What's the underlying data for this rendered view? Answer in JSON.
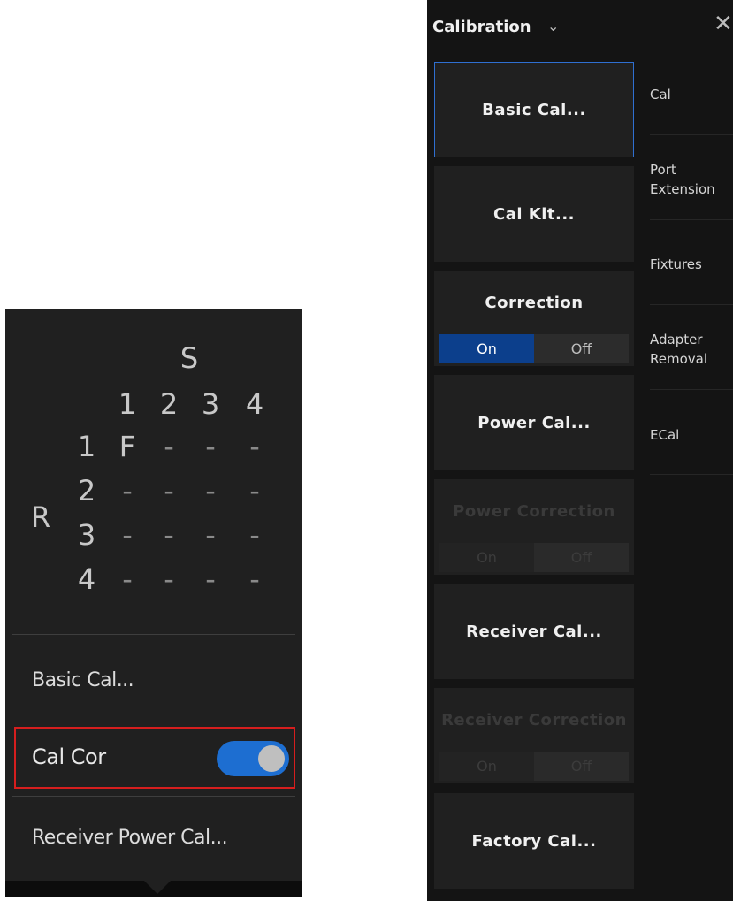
{
  "popup": {
    "matrix": {
      "col_header": "S",
      "row_header": "R",
      "columns": [
        "1",
        "2",
        "3",
        "4"
      ],
      "rows": [
        {
          "label": "1",
          "cells": [
            "F",
            "-",
            "-",
            "-"
          ]
        },
        {
          "label": "2",
          "cells": [
            "-",
            "-",
            "-",
            "-"
          ]
        },
        {
          "label": "3",
          "cells": [
            "-",
            "-",
            "-",
            "-"
          ]
        },
        {
          "label": "4",
          "cells": [
            "-",
            "-",
            "-",
            "-"
          ]
        }
      ]
    },
    "basic_cal_label": "Basic Cal...",
    "cal_cor_label": "Cal Cor",
    "cal_cor_on": true,
    "receiver_power_cal_label": "Receiver Power Cal..."
  },
  "panel": {
    "title": "Calibration",
    "title_chevron_icon": "chevron-down-icon",
    "close_icon": "close-icon",
    "buttons": {
      "basic_cal": "Basic Cal...",
      "cal_kit": "Cal Kit...",
      "power_cal": "Power Cal...",
      "receiver_cal": "Receiver Cal...",
      "factory_cal": "Factory Cal..."
    },
    "correction": {
      "label": "Correction",
      "on": "On",
      "off": "Off",
      "value": "On"
    },
    "power_correction": {
      "label": "Power Correction",
      "on": "On",
      "off": "Off",
      "value": "Off",
      "enabled": false
    },
    "receiver_correction": {
      "label": "Receiver Correction",
      "on": "On",
      "off": "Off",
      "value": "Off",
      "enabled": false
    },
    "tabs": [
      {
        "label": "Cal"
      },
      {
        "label": "Port\nExtension"
      },
      {
        "label": "Fixtures"
      },
      {
        "label": "Adapter\nRemoval"
      },
      {
        "label": "ECal"
      }
    ]
  },
  "colors": {
    "accent": "#1d6ed1",
    "selected_border": "#2f6fd1",
    "highlight_box": "#d61e1e",
    "panel_bg": "#141414",
    "button_bg": "#202020"
  }
}
